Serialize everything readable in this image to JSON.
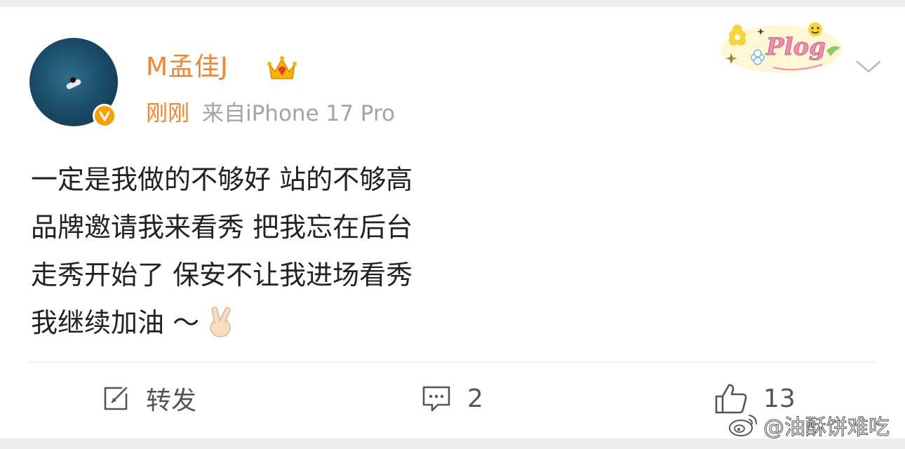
{
  "post": {
    "author": {
      "name": "M孟佳J",
      "avatar_icon": "avatar-image",
      "verified_icon": "verified-badge-icon",
      "badge_icon": "crown-icon"
    },
    "time": "刚刚",
    "source": "来自iPhone 17 Pro",
    "sticker_text": "Plog",
    "content_lines": [
      "一定是我做的不够好 站的不够高",
      "品牌邀请我来看秀 把我忘在后台",
      "走秀开始了 保安不让我进场看秀",
      "我继续加油 ～"
    ],
    "content_emoji": "finger-heart-emoji",
    "actions": {
      "repost_label": "转发",
      "comment_count": "2",
      "like_count": "13"
    }
  },
  "watermark": {
    "text": "@油酥饼难吃"
  },
  "colors": {
    "accent_orange": "#f08630",
    "verified_yellow": "#f5a000",
    "text_dark": "#222222",
    "text_gray": "#a3a3a3"
  }
}
